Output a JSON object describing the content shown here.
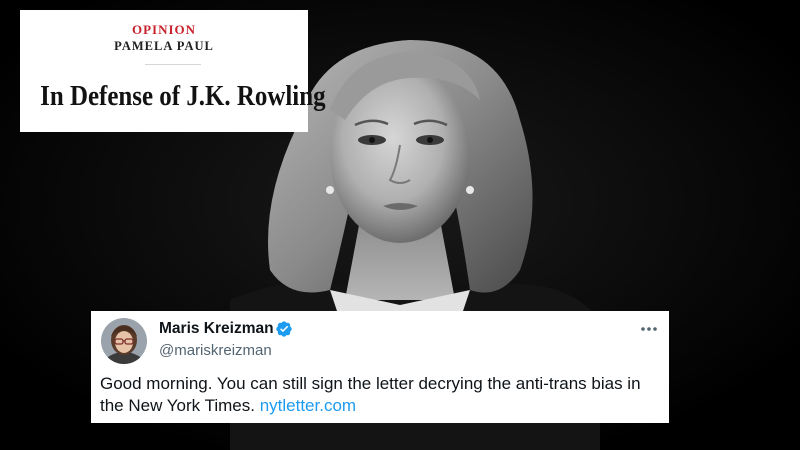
{
  "headline_card": {
    "section": "OPINION",
    "byline": "PAMELA PAUL",
    "headline": "In Defense of J.K. Rowling"
  },
  "tweet": {
    "display_name": "Maris Kreizman",
    "handle": "@mariskreizman",
    "text": "Good morning. You can still sign the letter decrying the anti-trans bias in the New York Times.",
    "link": "nytletter.com"
  },
  "colors": {
    "section_red": "#c8232c",
    "link_blue": "#1d9bf0",
    "verified_blue": "#1d9bf0",
    "background": "#000000"
  },
  "icons": [
    "verified-badge-icon",
    "more-options-icon"
  ]
}
